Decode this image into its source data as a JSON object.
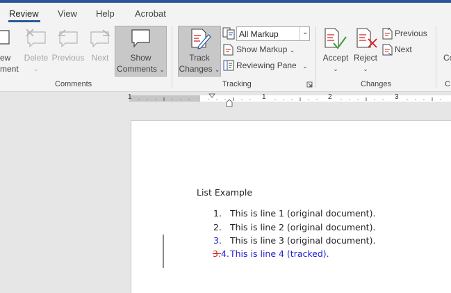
{
  "tabs": [
    {
      "label": "Review",
      "active": true
    },
    {
      "label": "View",
      "active": false
    },
    {
      "label": "Help",
      "active": false
    },
    {
      "label": "Acrobat",
      "active": false
    }
  ],
  "ribbon": {
    "partial_new_comment": {
      "line1": "ew",
      "line2": "ment"
    },
    "comments": {
      "delete": "Delete",
      "previous": "Previous",
      "next": "Next",
      "show_comments_line1": "Show",
      "show_comments_line2": "Comments",
      "group_label": "Comments"
    },
    "tracking": {
      "track_changes_line1": "Track",
      "track_changes_line2": "Changes",
      "markup_select": "All Markup",
      "show_markup": "Show Markup",
      "reviewing_pane": "Reviewing Pane",
      "group_label": "Tracking"
    },
    "changes": {
      "accept": "Accept",
      "reject": "Reject",
      "previous": "Previous",
      "next": "Next",
      "group_label": "Changes"
    },
    "partial_compare": {
      "label": "Co",
      "group_label": "C"
    }
  },
  "ruler": {
    "numbers": [
      "1",
      "1",
      "2",
      "3"
    ]
  },
  "document": {
    "heading": "List Example",
    "items": [
      {
        "number": "1.",
        "text": "This is line 1 (original document)."
      },
      {
        "number": "2.",
        "text": "This is line 2 (original document)."
      },
      {
        "number": "3.",
        "text": "This is line 3 (original document)."
      },
      {
        "deleted_number": "3.",
        "number": "4.",
        "text": "This is line 4 (tracked)."
      }
    ]
  },
  "colors": {
    "accent": "#2b579a",
    "tracked_insert": "#2020d0",
    "tracked_delete": "#d02020"
  }
}
